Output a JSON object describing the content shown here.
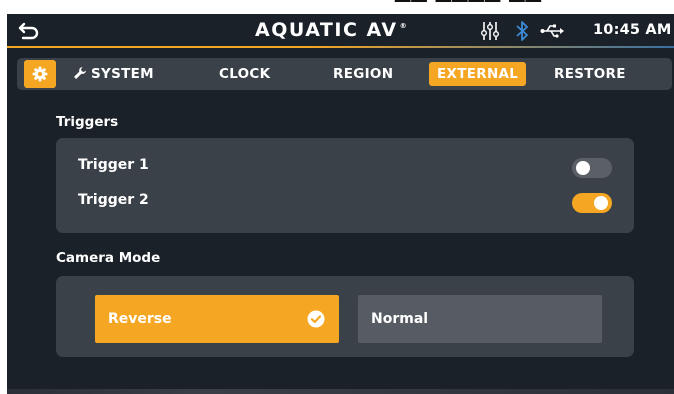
{
  "header": {
    "brand": "AQUATIC AV",
    "brand_mark": "®",
    "time": "10:45 AM"
  },
  "tabs": {
    "system": "SYSTEM",
    "clock": "CLOCK",
    "region": "REGION",
    "external": "EXTERNAL",
    "restore": "RESTORE",
    "active": "EXTERNAL"
  },
  "triggers": {
    "title": "Triggers",
    "items": [
      {
        "label": "Trigger 1",
        "on": false
      },
      {
        "label": "Trigger 2",
        "on": true
      }
    ]
  },
  "camera_mode": {
    "title": "Camera Mode",
    "options": [
      "Reverse",
      "Normal"
    ],
    "selected": "Reverse"
  },
  "colors": {
    "accent": "#f5a623",
    "background": "#1b2129",
    "panel": "#3b4149",
    "toggle_off": "#5b6068",
    "button_unselected": "#575c64"
  },
  "icons": {
    "back": "back-arrow-icon",
    "settings": "gear-icon",
    "system": "wrench-icon",
    "audio": "sliders-icon",
    "bluetooth": "bluetooth-icon",
    "usb": "usb-icon",
    "selected": "check-circle-icon"
  }
}
